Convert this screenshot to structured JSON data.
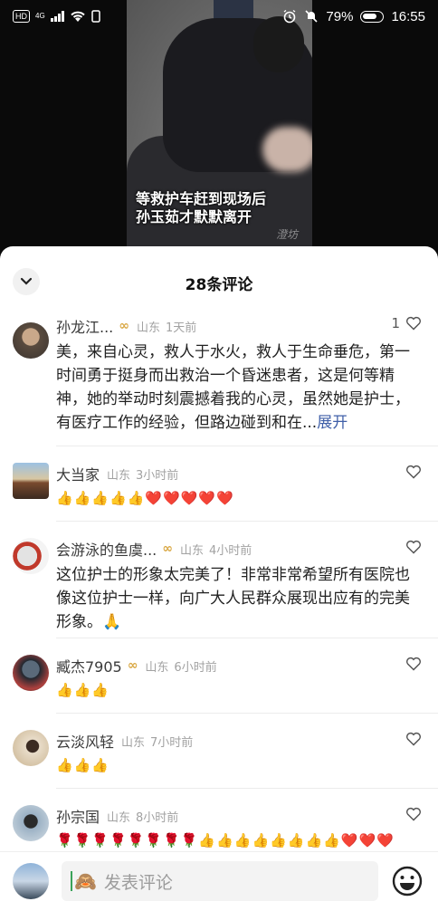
{
  "status_bar": {
    "hd": "HD",
    "network": "4G",
    "battery": "79%",
    "time": "16:55",
    "icons": [
      "signal-icon",
      "wifi-icon",
      "nfc-icon",
      "alarm-icon",
      "mute-icon",
      "battery-icon",
      "leaf-icon"
    ]
  },
  "video": {
    "caption_line1": "等救护车赶到现场后",
    "caption_line2": "孙玉茹才默默离开",
    "watermark": "澄坊"
  },
  "comments_panel": {
    "title": "28条评论",
    "comments": [
      {
        "name": "孙龙江...",
        "badge": "()",
        "location": "山东",
        "time": "1天前",
        "likes": "1",
        "text": "美，来自心灵，救人于水火，救人于生命垂危，第一时间勇于挺身而出救治一个昏迷患者，这是何等精神，她的举动时刻震撼着我的心灵，虽然她是护士，有医疗工作的经验，但路边碰到和在...",
        "expand": "展开"
      },
      {
        "name": "大当家",
        "location": "山东",
        "time": "3小时前",
        "text": "👍👍👍👍👍❤️❤️❤️❤️❤️"
      },
      {
        "name": "会游泳的鱼虞...",
        "badge": "()",
        "location": "山东",
        "time": "4小时前",
        "text": "这位护士的形象太完美了！非常非常希望所有医院也像这位护士一样，向广大人民群众展现出应有的完美形象。🙏"
      },
      {
        "name": "臧杰7905",
        "badge": "()",
        "location": "山东",
        "time": "6小时前",
        "text": "👍👍👍"
      },
      {
        "name": "云淡风轻",
        "location": "山东",
        "time": "7小时前",
        "text": "👍👍👍"
      },
      {
        "name": "孙宗国",
        "location": "山东",
        "time": "8小时前",
        "text": "🌹🌹🌹🌹🌹🌹🌹🌹👍👍👍👍👍👍👍👍❤️❤️❤️"
      }
    ]
  },
  "input_bar": {
    "placeholder": "发表评论",
    "emoji": "🙈"
  },
  "colors": {
    "badge_gold": "#d9a742",
    "link_blue": "#3f5fa8",
    "meta_gray": "#a2a2a2"
  }
}
